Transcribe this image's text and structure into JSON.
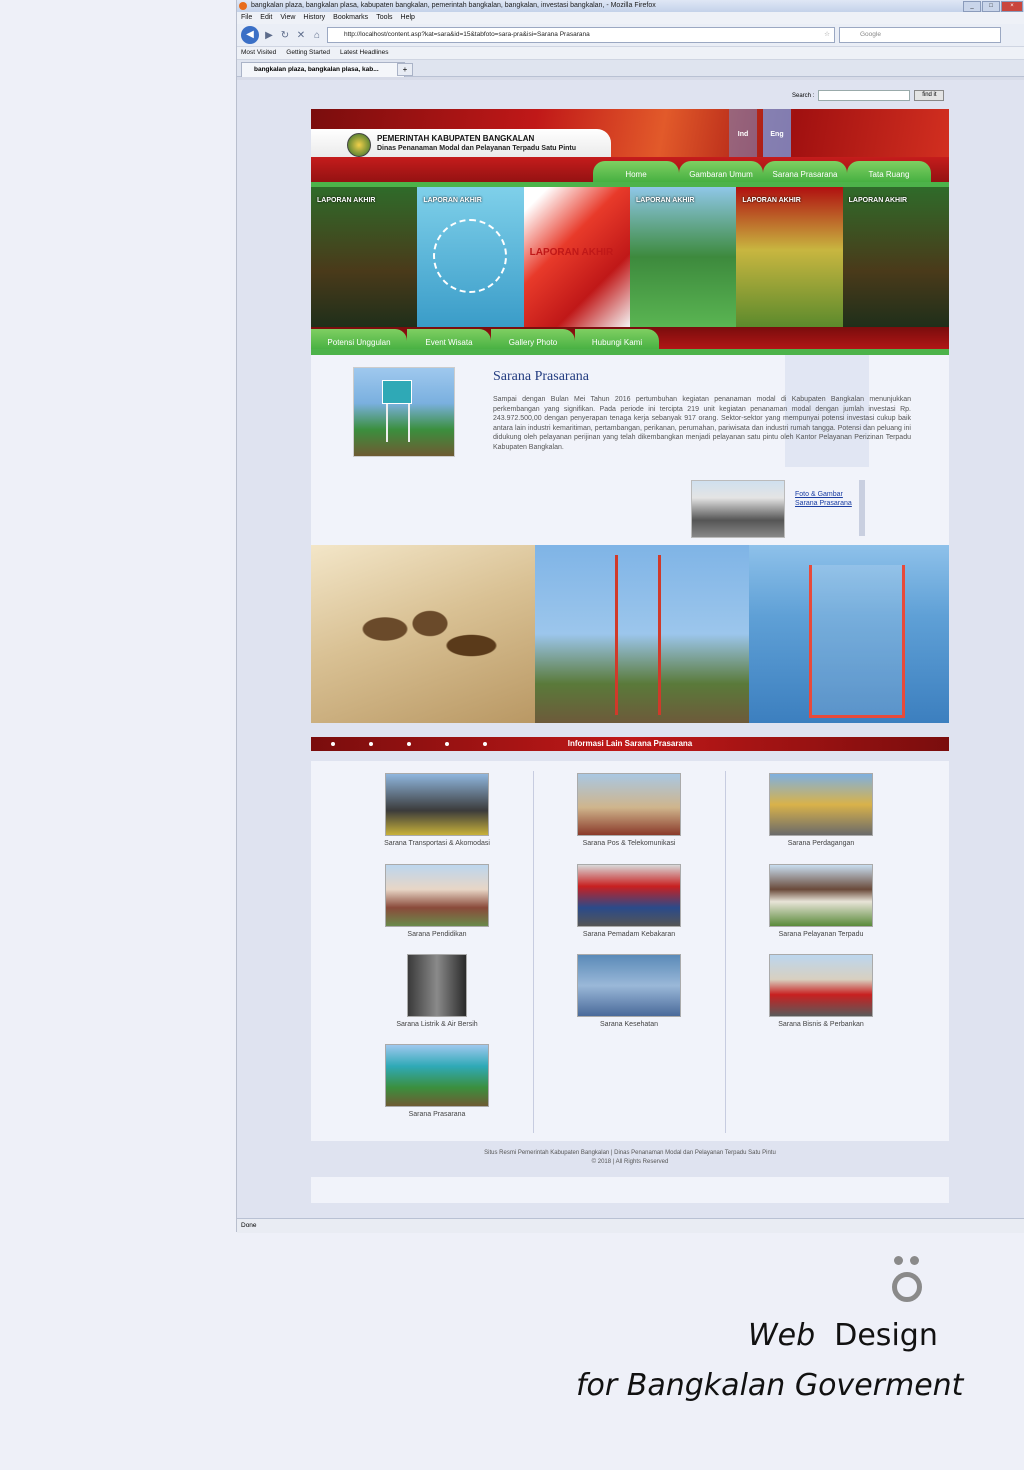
{
  "browser": {
    "title": "bangkalan plaza, bangkalan plasa, kabupaten bangkalan, pemerintah bangkalan, bangkalan, investasi bangkalan, - Mozilla Firefox",
    "menu": [
      "File",
      "Edit",
      "View",
      "History",
      "Bookmarks",
      "Tools",
      "Help"
    ],
    "url": "http://localhost/content.asp?kat=sara&id=15&tabfoto=sara-pra&isi=Sarana Prasarana",
    "search_placeholder": "Google",
    "bookmarks": [
      "Most Visited",
      "Getting Started",
      "Latest Headlines"
    ],
    "tab_title": "bangkalan plaza, bangkalan plasa, kab...",
    "status": "Done"
  },
  "site": {
    "search_label": "Search :",
    "search_button": "find it",
    "org_line1": "PEMERINTAH KABUPATEN BANGKALAN",
    "org_line2": "Dinas Penanaman Modal dan Pelayanan Terpadu Satu Pintu",
    "lang_ind": "Ind",
    "lang_eng": "Eng",
    "nav": [
      "Home",
      "Gambaran Umum",
      "Sarana Prasarana",
      "Tata Ruang"
    ],
    "banner_labels": [
      "LAPORAN AKHIR",
      "LAPORAN AKHIR",
      "LAPORAN AKHIR",
      "LAPORAN AKHIR",
      "LAPORAN AKHIR",
      "LAPORAN AKHIR"
    ],
    "subnav": [
      "Potensi Unggulan",
      "Event Wisata",
      "Gallery Photo",
      "Hubungi Kami"
    ],
    "content_title": "Sarana Prasarana",
    "content_text": "Sampai dengan Bulan Mei Tahun 2016 pertumbuhan kegiatan penanaman modal di Kabupaten Bangkalan menunjukkan perkembangan yang signifikan. Pada periode ini tercipta 219 unit kegiatan penanaman modal dengan jumlah investasi Rp. 243.972.500,00 dengan penyerapan tenaga kerja sebanyak 917 orang. Sektor-sektor yang mempunyai potensi investasi cukup baik antara lain industri kemaritiman, pertambangan, perikanan, perumahan, pariwisata dan industri rumah tangga. Potensi dan peluang ini didukung oleh pelayanan perijinan yang telah dikembangkan menjadi pelayanan satu pintu oleh Kantor Pelayanan Perizinan Terpadu Kabupaten Bangkalan.",
    "foto_link": "Foto & Gambar Sarana Prasarana",
    "info_title": "Informasi Lain Sarana Prasarana",
    "items": [
      "Sarana Transportasi & Akomodasi",
      "Sarana Pos & Telekomunikasi",
      "Sarana Perdagangan",
      "Sarana Pendidikan",
      "Sarana Pemadam Kebakaran",
      "Sarana Pelayanan Terpadu",
      "Sarana Listrik & Air Bersih",
      "Sarana Kesehatan",
      "Sarana Bisnis & Perbankan",
      "Sarana Prasarana"
    ],
    "footer_line1": "Situs Resmi Pemerintah Kabupaten Bangkalan | Dinas Penanaman Modal dan Pelayanan Terpadu Satu Pintu",
    "footer_line2": "© 2018 | All Rights Reserved"
  },
  "caption": {
    "line1_a": "Web",
    "line1_b": "Design",
    "line2": "for Bangkalan Goverment"
  },
  "colors": {
    "brand_red": "#c01818",
    "brand_green": "#4db34a",
    "link_blue": "#1b3ea3"
  }
}
